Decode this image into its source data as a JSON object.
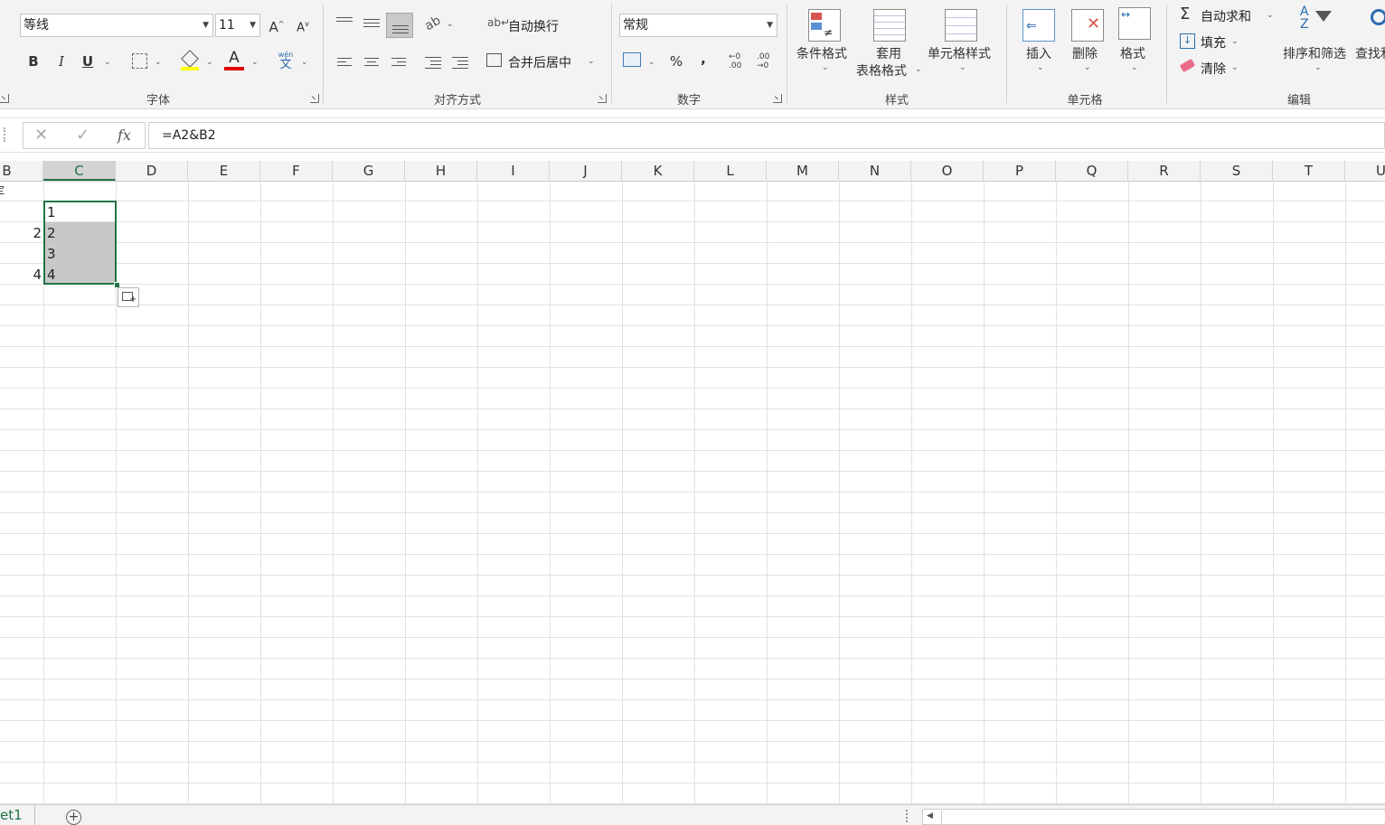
{
  "font_group": {
    "font_name": "等线",
    "font_size": "11",
    "grow_label": "A",
    "shrink_label": "A",
    "bold": "B",
    "italic": "I",
    "underline": "U",
    "font_color_letter": "A",
    "phonetic_top": "wén",
    "phonetic_char": "文",
    "label": "字体"
  },
  "align_group": {
    "wrap_text": "自动换行",
    "merge_center": "合并后居中",
    "label": "对齐方式"
  },
  "number_group": {
    "format": "常规",
    "percent": "%",
    "comma": ",",
    "inc_decimal_top": "←0",
    "inc_decimal_bottom": ".00",
    "dec_decimal_top": ".00",
    "dec_decimal_bottom": "→0",
    "label": "数字"
  },
  "styles_group": {
    "conditional": "条件格式",
    "table_format_1": "套用",
    "table_format_2": "表格格式",
    "cell_styles": "单元格样式",
    "label": "样式"
  },
  "cells_group": {
    "insert": "插入",
    "delete": "删除",
    "format": "格式",
    "label": "单元格"
  },
  "editing_group": {
    "autosum": "自动求和",
    "fill": "填充",
    "clear": "清除",
    "sort_filter": "排序和筛选",
    "find_select": "查找和",
    "label": "编辑"
  },
  "formula_bar": {
    "fx": "fx",
    "formula": "=A2&B2"
  },
  "columns": [
    "B",
    "C",
    "D",
    "E",
    "F",
    "G",
    "H",
    "I",
    "J",
    "K",
    "L",
    "M",
    "N",
    "O",
    "P",
    "Q",
    "R",
    "S",
    "T",
    "U"
  ],
  "selected_column": "C",
  "cells": {
    "b1_partial": "定",
    "b2": "2",
    "b4": "4",
    "c1": "1",
    "c2": "2",
    "c3": "3",
    "c4": "4"
  },
  "sheet_tab": "et1",
  "add_sheet": "+"
}
